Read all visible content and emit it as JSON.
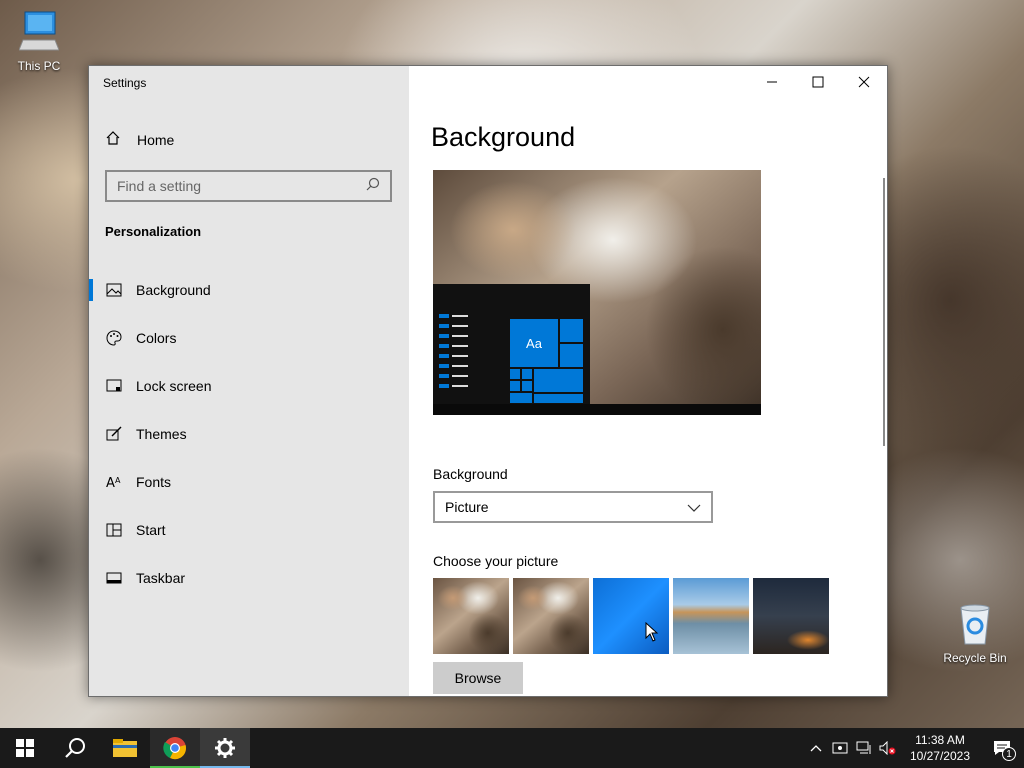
{
  "desktop": {
    "icons": [
      {
        "label": "This PC"
      },
      {
        "label": "Recycle Bin"
      }
    ]
  },
  "window": {
    "title": "Settings",
    "controls": {
      "minimize": "minimize",
      "maximize": "maximize",
      "close": "close"
    }
  },
  "sidebar": {
    "home_label": "Home",
    "search_placeholder": "Find a setting",
    "section_title": "Personalization",
    "items": [
      {
        "label": "Background",
        "icon": "picture-icon",
        "active": true
      },
      {
        "label": "Colors",
        "icon": "palette-icon"
      },
      {
        "label": "Lock screen",
        "icon": "lock-screen-icon"
      },
      {
        "label": "Themes",
        "icon": "themes-icon"
      },
      {
        "label": "Fonts",
        "icon": "fonts-icon"
      },
      {
        "label": "Start",
        "icon": "start-icon"
      },
      {
        "label": "Taskbar",
        "icon": "taskbar-icon"
      }
    ]
  },
  "main": {
    "title": "Background",
    "preview_tile_text": "Aa",
    "background_label": "Background",
    "background_value": "Picture",
    "choose_label": "Choose your picture",
    "browse_label": "Browse"
  },
  "taskbar": {
    "clock_time": "11:38 AM",
    "clock_date": "10/27/2023",
    "notification_count": "1"
  },
  "colors": {
    "accent": "#0078d7",
    "sidebar_bg": "#e6e6e6",
    "taskbar_bg": "#1a1a1a"
  }
}
